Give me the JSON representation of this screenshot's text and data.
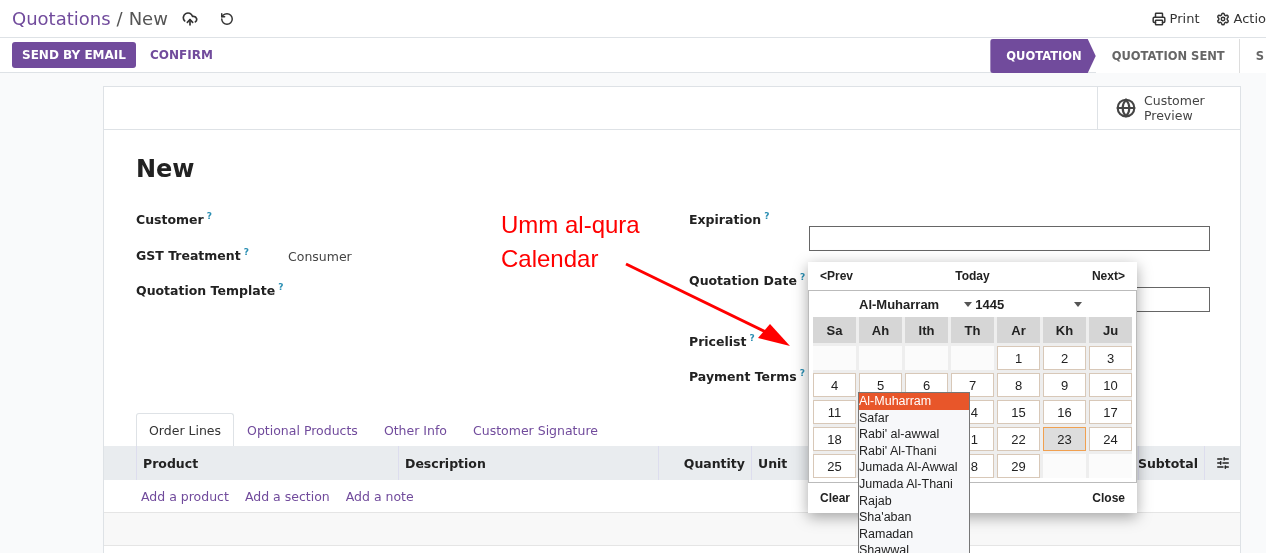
{
  "breadcrumb": {
    "parent": "Quotations",
    "separator": "/",
    "current": "New"
  },
  "top_actions": [
    {
      "kind": "print",
      "label": "Print"
    },
    {
      "kind": "gear",
      "label": "Actio"
    }
  ],
  "buttons": [
    {
      "kind": "primary",
      "label": "SEND BY EMAIL"
    },
    {
      "kind": "secondary",
      "label": "CONFIRM"
    }
  ],
  "stages": [
    {
      "label": "QUOTATION",
      "selected": true
    },
    {
      "label": "QUOTATION SENT",
      "selected": false
    },
    {
      "label": "S",
      "selected": false
    }
  ],
  "preview_button": "Customer Preview",
  "title": "New",
  "left_fields": [
    {
      "label": "Customer",
      "help": "?"
    },
    {
      "label": "GST Treatment",
      "help": "?",
      "value": "Consumer"
    },
    {
      "label": "Quotation Template",
      "help": "?"
    }
  ],
  "right_fields": [
    {
      "kind": "input",
      "label": "Expiration",
      "help": "?"
    },
    {
      "kind": "input",
      "label": "Quotation Date",
      "help": "?"
    },
    {
      "kind": "plain",
      "label": "Pricelist",
      "help": "?"
    },
    {
      "kind": "plain",
      "label": "Payment Terms",
      "help": "?"
    }
  ],
  "annotation": {
    "lines": [
      "Umm al-qura",
      "Calendar"
    ]
  },
  "tabs": [
    {
      "label": "Order Lines",
      "selected": true
    },
    {
      "label": "Optional Products",
      "selected": false
    },
    {
      "label": "Other Info",
      "selected": false
    },
    {
      "label": "Customer Signature",
      "selected": false
    }
  ],
  "table": {
    "columns": [
      {
        "label": "Product",
        "kind": "text"
      },
      {
        "label": "Description",
        "kind": "text"
      },
      {
        "label": "Quantity",
        "kind": "number"
      },
      {
        "label": "Unit",
        "kind": "text"
      },
      {
        "label": "Subtotal",
        "kind": "number"
      }
    ],
    "add_links": [
      "Add a product",
      "Add a section",
      "Add a note"
    ]
  },
  "datepicker": {
    "prev": "<Prev",
    "today": "Today",
    "next": "Next>",
    "month": "Al-Muharram",
    "year": "1445",
    "weekdays": [
      "Sa",
      "Ah",
      "Ith",
      "Th",
      "Ar",
      "Kh",
      "Ju"
    ],
    "weeks": [
      [
        {
          "kind": "blank"
        },
        {
          "kind": "blank"
        },
        {
          "kind": "blank"
        },
        {
          "kind": "blank"
        },
        {
          "kind": "day",
          "day": "1",
          "selected": false
        },
        {
          "kind": "day",
          "day": "2",
          "selected": false
        },
        {
          "kind": "day",
          "day": "3",
          "selected": false
        }
      ],
      [
        {
          "kind": "day",
          "day": "4",
          "selected": false
        },
        {
          "kind": "day",
          "day": "5",
          "selected": false
        },
        {
          "kind": "day",
          "day": "6",
          "selected": false
        },
        {
          "kind": "day",
          "day": "7",
          "selected": false
        },
        {
          "kind": "day",
          "day": "8",
          "selected": false
        },
        {
          "kind": "day",
          "day": "9",
          "selected": false
        },
        {
          "kind": "day",
          "day": "10",
          "selected": false
        }
      ],
      [
        {
          "kind": "day",
          "day": "11",
          "selected": false
        },
        {
          "kind": "covered"
        },
        {
          "kind": "covered"
        },
        {
          "kind": "partial",
          "day": "4",
          "selected": false
        },
        {
          "kind": "day",
          "day": "15",
          "selected": false
        },
        {
          "kind": "day",
          "day": "16",
          "selected": false
        },
        {
          "kind": "day",
          "day": "17",
          "selected": false
        }
      ],
      [
        {
          "kind": "day",
          "day": "18",
          "selected": false
        },
        {
          "kind": "covered"
        },
        {
          "kind": "covered"
        },
        {
          "kind": "partial",
          "day": "1",
          "selected": false
        },
        {
          "kind": "day",
          "day": "22",
          "selected": false
        },
        {
          "kind": "day",
          "day": "23",
          "selected": true
        },
        {
          "kind": "day",
          "day": "24",
          "selected": false
        }
      ],
      [
        {
          "kind": "day",
          "day": "25",
          "selected": false
        },
        {
          "kind": "covered"
        },
        {
          "kind": "covered"
        },
        {
          "kind": "partial",
          "day": "8",
          "selected": false
        },
        {
          "kind": "day",
          "day": "29",
          "selected": false
        },
        {
          "kind": "blank"
        },
        {
          "kind": "blank"
        }
      ]
    ],
    "clear": "Clear",
    "close": "Close"
  },
  "month_menu": [
    {
      "label": "Al-Muharram",
      "selected": true
    },
    {
      "label": "Safar",
      "selected": false
    },
    {
      "label": "Rabi' al-awwal",
      "selected": false
    },
    {
      "label": "Rabi' Al-Thani",
      "selected": false
    },
    {
      "label": "Jumada Al-Awwal",
      "selected": false
    },
    {
      "label": "Jumada Al-Thani",
      "selected": false
    },
    {
      "label": "Rajab",
      "selected": false
    },
    {
      "label": "Sha'aban",
      "selected": false
    },
    {
      "label": "Ramadan",
      "selected": false
    },
    {
      "label": "Shawwal",
      "selected": false
    }
  ]
}
